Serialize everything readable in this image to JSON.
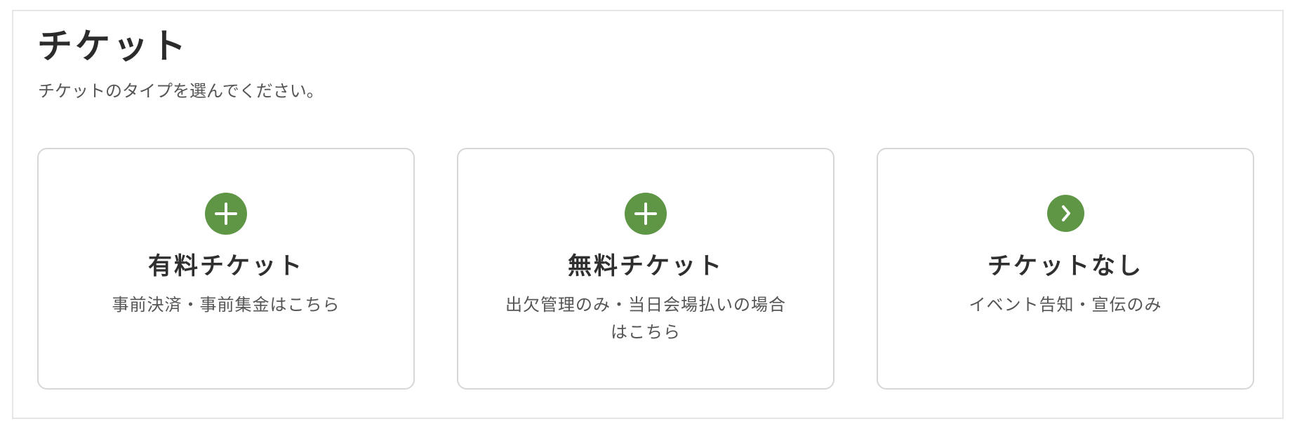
{
  "header": {
    "title": "チケット",
    "subtitle": "チケットのタイプを選んでください。"
  },
  "cards": [
    {
      "title": "有料チケット",
      "description": "事前決済・事前集金はこちら",
      "icon": "plus-circle-icon"
    },
    {
      "title": "無料チケット",
      "description": "出欠管理のみ・当日会場払いの場合はこちら",
      "icon": "plus-circle-icon"
    },
    {
      "title": "チケットなし",
      "description": "イベント告知・宣伝のみ",
      "icon": "chevron-right-circle-icon"
    }
  ],
  "colors": {
    "accent": "#5e9646",
    "card_border": "#d7d7d7",
    "panel_border": "#e6e6e6",
    "title_text": "#2b2b2b",
    "secondary_text": "#555555"
  }
}
